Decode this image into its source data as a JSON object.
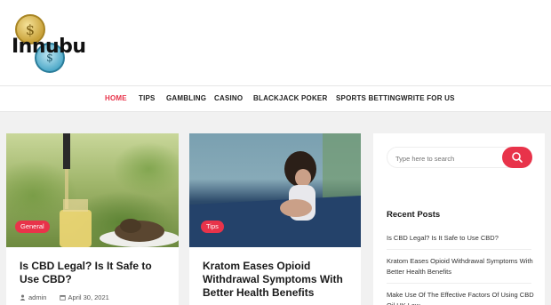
{
  "brand": {
    "name": "Innubu",
    "coin_symbol_1": "$",
    "coin_symbol_2": "$"
  },
  "nav": {
    "items": [
      {
        "label": "HOME",
        "active": true
      },
      {
        "label": "TIPS"
      },
      {
        "label": "GAMBLING"
      },
      {
        "label": "CASINO"
      },
      {
        "label": "BLACKJACK"
      },
      {
        "label": "POKER"
      },
      {
        "label": "SPORTS BETTING"
      },
      {
        "label": "WRITE FOR US"
      }
    ]
  },
  "posts": [
    {
      "tag": "General",
      "title": "Is CBD Legal? Is It Safe to Use CBD?",
      "author": "admin",
      "date": "April 30, 2021",
      "image_icon": "cbd-oil-dropper-photo"
    },
    {
      "tag": "Tips",
      "title": "Kratom Eases Opioid Withdrawal Symptoms With Better Health Benefits",
      "image_icon": "woman-sitting-on-bed-photo"
    }
  ],
  "sidebar": {
    "search": {
      "placeholder": "Type here to search",
      "button_icon": "search-icon"
    },
    "recent_posts_title": "Recent Posts",
    "recent_posts": [
      "Is CBD Legal? Is It Safe to Use CBD?",
      "Kratom Eases Opioid Withdrawal Symptoms With Better Health Benefits",
      "Make Use Of The Effective Factors Of Using CBD Oil UK Law"
    ]
  },
  "colors": {
    "accent": "#e8334a",
    "background": "#f1f1f1",
    "card": "#ffffff"
  }
}
